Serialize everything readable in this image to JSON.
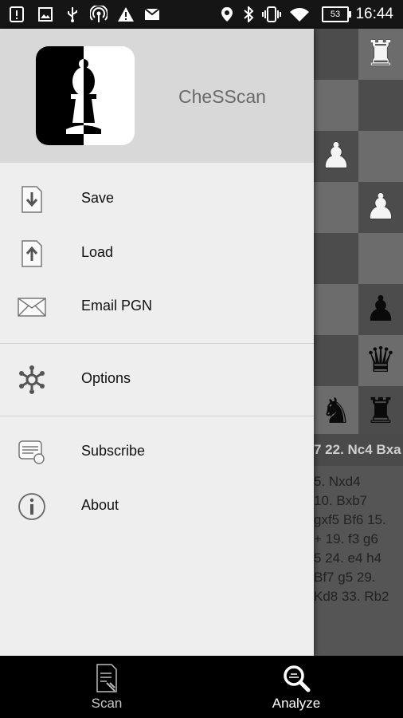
{
  "status_bar": {
    "time": "16:44",
    "battery": "53",
    "icons": [
      "notification-icon",
      "image-icon",
      "usb-icon",
      "hotspot-icon",
      "warning-icon",
      "mail-icon",
      "location-icon",
      "bluetooth-icon",
      "vibrate-icon",
      "wifi-icon",
      "battery-icon"
    ]
  },
  "drawer": {
    "app_name": "CheSScan",
    "items": [
      {
        "label": "Save",
        "icon": "save-icon"
      },
      {
        "label": "Load",
        "icon": "load-icon"
      },
      {
        "label": "Email PGN",
        "icon": "email-icon"
      },
      {
        "label": "Options",
        "icon": "options-icon"
      },
      {
        "label": "Subscribe",
        "icon": "subscribe-icon"
      },
      {
        "label": "About",
        "icon": "about-icon"
      }
    ]
  },
  "background": {
    "move_bar": "7 22. Nc4 Bxa",
    "pgn_lines": [
      "5. Nxd4",
      "10. Bxb7",
      "gxf5 Bf6 15.",
      "+ 19. f3 g6",
      "5 24. e4 h4",
      "Bf7 g5 29.",
      "Kd8 33. Rb2"
    ]
  },
  "bottom_nav": {
    "scan_label": "Scan",
    "analyze_label": "Analyze"
  }
}
